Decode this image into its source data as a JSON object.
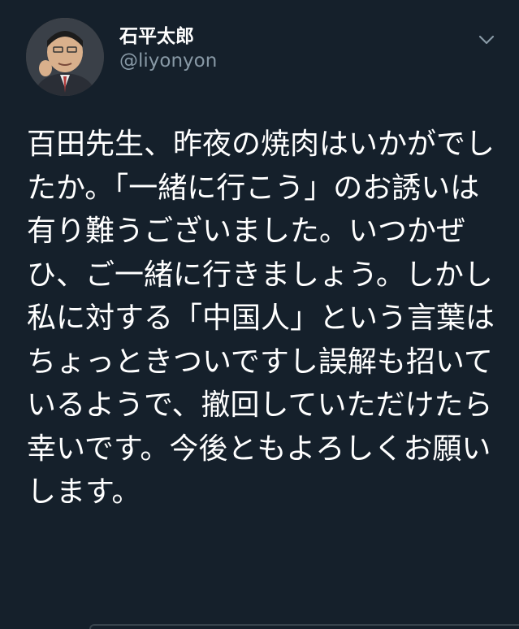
{
  "tweet": {
    "author": {
      "display_name": "石平太郎",
      "handle": "@liyonyon",
      "avatar_icon": "profile-photo"
    },
    "menu_icon": "chevron-down-icon",
    "text": "百田先生、昨夜の焼肉はいかがでしたか。「一緒に行こう」のお誘いは有り難うございました。いつかぜひ、ご一緒に行きましょう。しかし私に対する「中国人」という言葉はちょっときついですし誤解も招いているようで、撤回していただけたら幸いです。今後ともよろしくお願いします。"
  },
  "colors": {
    "background": "#15202b",
    "primary_text": "#ffffff",
    "secondary_text": "#8899a6",
    "divider": "#38444d"
  }
}
